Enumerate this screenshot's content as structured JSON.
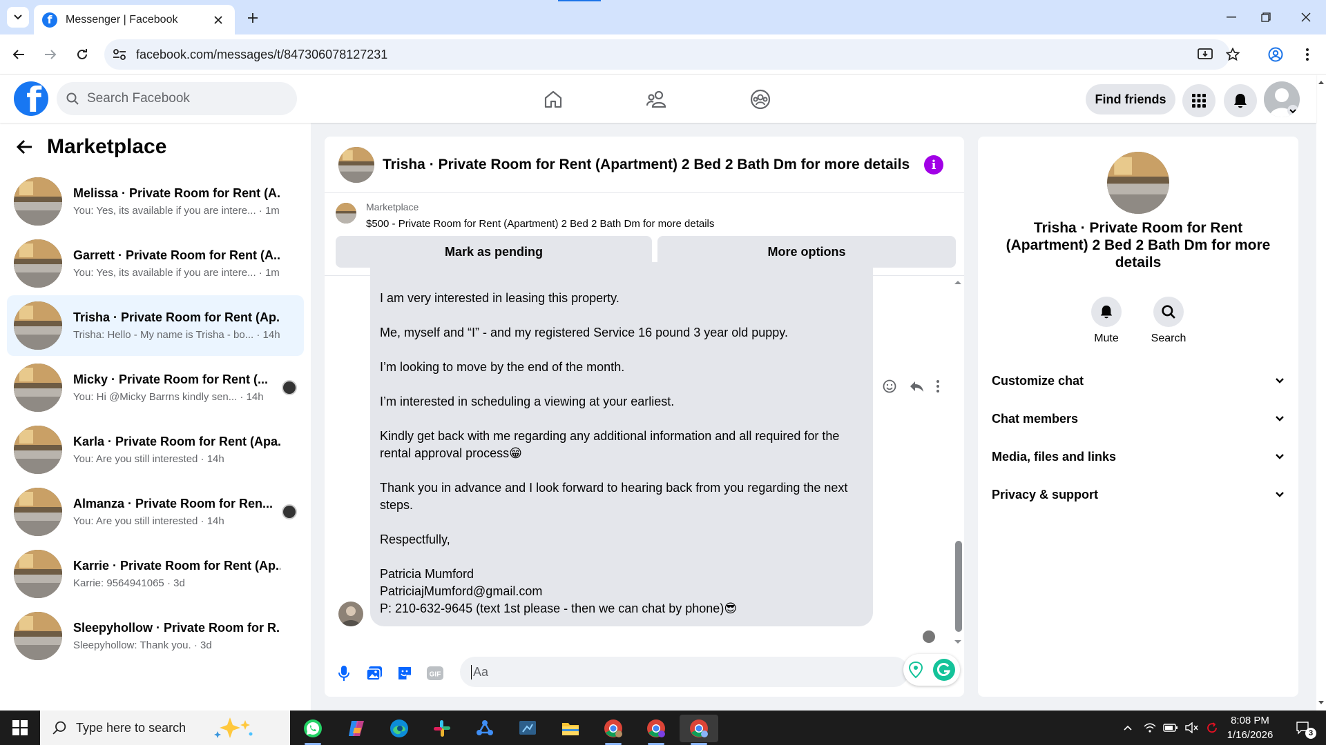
{
  "browser": {
    "tab_title": "Messenger | Facebook",
    "url": "facebook.com/messages/t/847306078127231"
  },
  "fb": {
    "logo_letter": "f",
    "search_placeholder": "Search Facebook",
    "find_friends": "Find friends"
  },
  "left": {
    "title": "Marketplace",
    "conversations": [
      {
        "name": "Melissa · Private Room for Rent (A...",
        "preview": "You: Yes, its available if you are intere... · 1m"
      },
      {
        "name": "Garrett · Private Room for Rent (A...",
        "preview": "You: Yes, its available if you are intere... · 1m"
      },
      {
        "name": "Trisha · Private Room for Rent (Ap...",
        "preview": "Trisha: Hello - My name is Trisha - bo... · 14h"
      },
      {
        "name": "Micky · Private Room for Rent (...",
        "preview": "You: Hi @Micky Barrns kindly sen... · 14h"
      },
      {
        "name": "Karla · Private Room for Rent (Apa...",
        "preview": "You: Are you still interested · 14h"
      },
      {
        "name": "Almanza · Private Room for Ren...",
        "preview": "You: Are you still interested · 14h"
      },
      {
        "name": "Karrie · Private Room for Rent (Ap...",
        "preview": "Karrie: 9564941065 · 3d"
      },
      {
        "name": "Sleepyhollow · Private Room for R...",
        "preview": "Sleepyhollow: Thank you. · 3d"
      }
    ]
  },
  "chat": {
    "title": "Trisha · Private Room for Rent (Apartment) 2 Bed 2 Bath Dm for more details",
    "info_letter": "i",
    "marketplace_label": "Marketplace",
    "listing": "$500 - Private Room for Rent (Apartment) 2 Bed 2 Bath Dm for more details",
    "btn_pending": "Mark as pending",
    "btn_more": "More options",
    "message": {
      "p1": "I am very interested in leasing this property.",
      "p2": "Me, myself and “I” - and my registered Service 16 pound 3 year old puppy.",
      "p3": "I’m looking to move by the end of the month.",
      "p4": "I’m interested in scheduling a viewing at your earliest.",
      "p5": "Kindly get back with me regarding any additional information and all required for the rental approval process😁",
      "p6": "Thank you in advance and I look forward to hearing back from you regarding the next steps.",
      "p7": "Respectfully,",
      "sig_name": "Patricia Mumford",
      "sig_email": "PatriciajMumford@gmail.com",
      "sig_phone": "P: 210-632-9645 (text 1st please - then we can chat by phone)😎"
    },
    "composer_placeholder": "Aa"
  },
  "info": {
    "name": "Trisha · Private Room for Rent (Apartment) 2 Bed 2 Bath Dm for more details",
    "mute": "Mute",
    "search": "Search",
    "sections": [
      "Customize chat",
      "Chat members",
      "Media, files and links",
      "Privacy & support"
    ]
  },
  "taskbar": {
    "search_placeholder": "Type here to search",
    "time": "8:08 PM",
    "date": "1/16/2026",
    "notif_count": "3"
  },
  "colors": {
    "fb_blue": "#1877f2",
    "active_conv": "#ebf5ff",
    "bubble": "#e4e6eb",
    "info_purple": "#a100e6"
  }
}
